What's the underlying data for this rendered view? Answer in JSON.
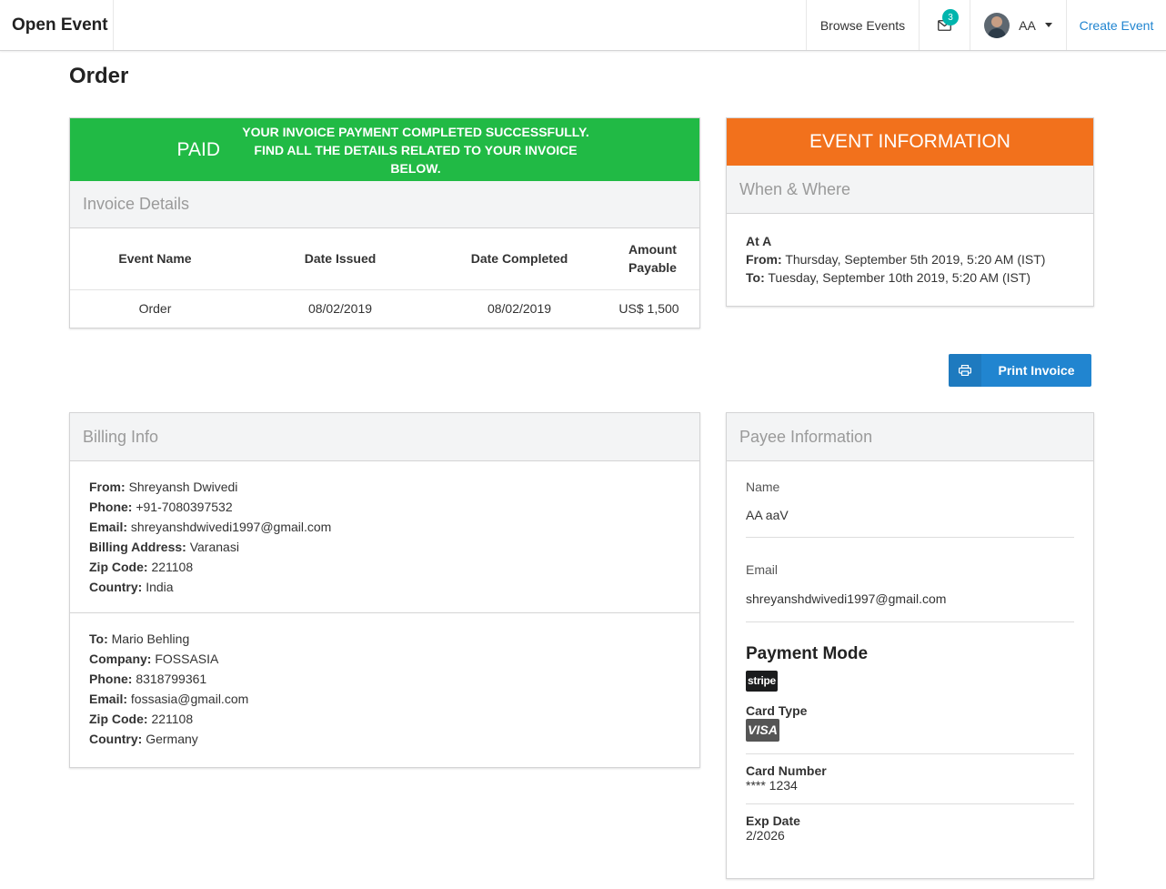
{
  "nav": {
    "brand": "Open Event",
    "browse_events": "Browse Events",
    "mail_count": "3",
    "user_name": "AA",
    "create_event": "Create Event"
  },
  "page": {
    "title": "Order"
  },
  "invoice": {
    "status": "PAID",
    "message_line1": "YOUR INVOICE PAYMENT COMPLETED SUCCESSFULLY.",
    "message_line2": "FIND ALL THE DETAILS RELATED TO YOUR INVOICE BELOW.",
    "section_title": "Invoice Details",
    "columns": [
      "Event Name",
      "Date Issued",
      "Date Completed",
      "Amount Payable"
    ],
    "row": [
      "Order",
      "08/02/2019",
      "08/02/2019",
      "US$ 1,500"
    ]
  },
  "event_info": {
    "banner": "EVENT INFORMATION",
    "section_title": "When & Where",
    "location": "At A",
    "from_label": "From:",
    "from_value": "Thursday, September 5th 2019, 5:20 AM (IST)",
    "to_label": "To:",
    "to_value": "Tuesday, September 10th 2019, 5:20 AM (IST)"
  },
  "print_button": "Print Invoice",
  "billing": {
    "section_title": "Billing Info",
    "from": [
      {
        "label": "From:",
        "value": "Shreyansh Dwivedi"
      },
      {
        "label": "Phone:",
        "value": "+91-7080397532"
      },
      {
        "label": "Email:",
        "value": "shreyanshdwivedi1997@gmail.com"
      },
      {
        "label": "Billing Address:",
        "value": "Varanasi"
      },
      {
        "label": "Zip Code:",
        "value": "221108"
      },
      {
        "label": "Country:",
        "value": "India"
      }
    ],
    "to": [
      {
        "label": "To:",
        "value": "Mario Behling"
      },
      {
        "label": "Company:",
        "value": "FOSSASIA"
      },
      {
        "label": "Phone:",
        "value": "8318799361"
      },
      {
        "label": "Email:",
        "value": "fossasia@gmail.com"
      },
      {
        "label": "Zip Code:",
        "value": "221108"
      },
      {
        "label": "Country:",
        "value": "Germany"
      }
    ]
  },
  "payee": {
    "section_title": "Payee Information",
    "name_label": "Name",
    "name_value": "AA aaV",
    "email_label": "Email",
    "email_value": "shreyanshdwivedi1997@gmail.com",
    "payment_mode_title": "Payment Mode",
    "payment_logo": "stripe",
    "card_type_label": "Card Type",
    "card_logo": "VISA",
    "card_number_label": "Card Number",
    "card_number_value": "**** 1234",
    "exp_label": "Exp Date",
    "exp_value": "2/2026"
  },
  "colors": {
    "paid_green": "#21ba45",
    "event_orange": "#f2711c",
    "primary_blue": "#2185d0",
    "badge_teal": "#00b5ad"
  }
}
